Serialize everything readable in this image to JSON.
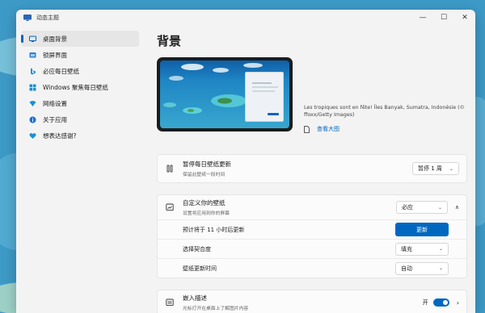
{
  "window": {
    "title": "动态主题",
    "controls": {
      "minimize": "—",
      "maximize": "☐",
      "close": "✕"
    }
  },
  "sidebar": {
    "items": [
      {
        "label": "桌面背景",
        "icon": "desktop-icon",
        "active": true
      },
      {
        "label": "锁屏界面",
        "icon": "lock-screen-icon",
        "active": false
      },
      {
        "label": "必应每日壁纸",
        "icon": "bing-icon",
        "active": false
      },
      {
        "label": "Windows 聚焦每日壁纸",
        "icon": "spotlight-icon",
        "active": false
      },
      {
        "label": "网络设置",
        "icon": "network-icon",
        "active": false
      },
      {
        "label": "关于应用",
        "icon": "info-icon",
        "active": false
      },
      {
        "label": "想表达感谢?",
        "icon": "heart-icon",
        "active": false
      }
    ]
  },
  "main": {
    "title": "背景",
    "credit": {
      "text": "Les tropiques sont en fête! Îles Banyak, Sumatra, Indonésie (© ffoxx/Getty Images)",
      "link": "查看大图"
    },
    "pause_card": {
      "title": "暂停每日壁纸更新",
      "subtitle": "保留此壁纸一段时间",
      "select_value": "暂停 1 周"
    },
    "custom_card": {
      "title": "自定义你的壁纸",
      "subtitle": "设置将应用到你的屏幕",
      "select_value": "必应",
      "rows": [
        {
          "label": "预计将于 11 小时后更新",
          "control": "button",
          "value": "更新"
        },
        {
          "label": "选择契合度",
          "control": "select",
          "value": "填充"
        },
        {
          "label": "壁纸更新时间",
          "control": "select",
          "value": "自动"
        }
      ]
    },
    "embed_card": {
      "title": "嵌入描述",
      "subtitle": "光标打开在桌面上了解图片内容",
      "toggle_label": "开",
      "toggle_on": true
    }
  },
  "colors": {
    "accent": "#0067c0",
    "window_bg": "#f3f3f3",
    "card_bg": "#fbfbfb"
  }
}
